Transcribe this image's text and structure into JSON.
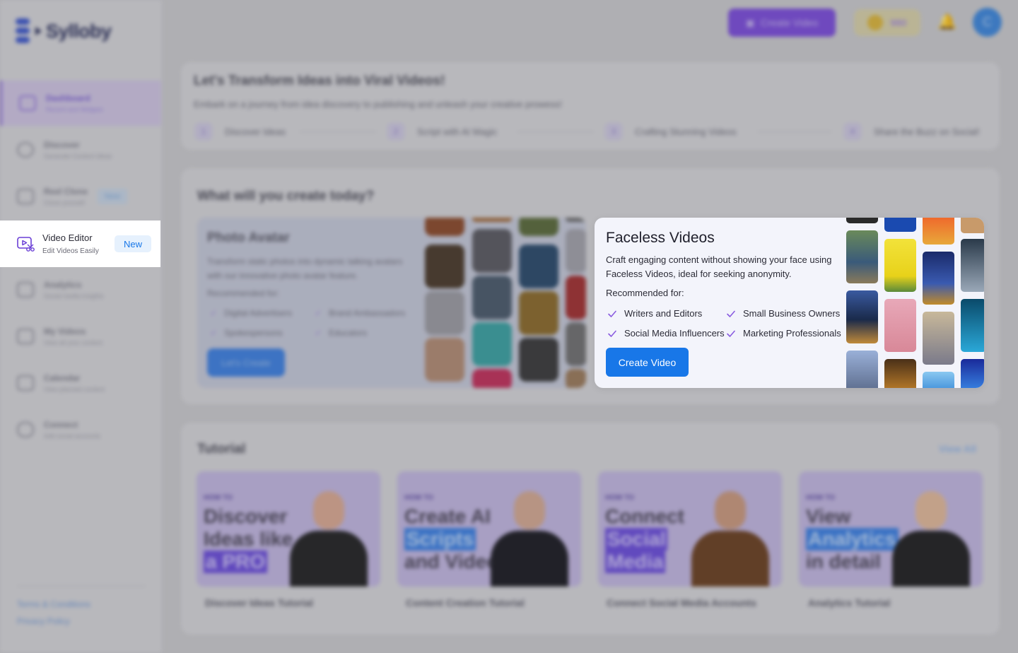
{
  "brand": {
    "name": "Sylloby"
  },
  "colors": {
    "accent": "#1877e8",
    "purple": "#7a4cd8",
    "badge_bg": "#e6f1fd"
  },
  "topbar": {
    "create_label": "Create Video",
    "coins": "980",
    "avatar_initial": "C"
  },
  "sidebar": {
    "items": [
      {
        "title": "Dashboard",
        "sub": "Recent and Widgets",
        "icon": "grid-icon"
      },
      {
        "title": "Discover",
        "sub": "Generate Content Ideas",
        "icon": "search-icon"
      },
      {
        "title": "Reel Clone",
        "sub": "Clone yourself",
        "badge": "New",
        "icon": "clone-icon"
      },
      {
        "title": "Video Editor",
        "sub": "Edit Videos Easily",
        "badge": "New",
        "icon": "video-edit-icon"
      },
      {
        "title": "Analytics",
        "sub": "Social media insights",
        "icon": "chart-icon"
      },
      {
        "title": "My Videos",
        "sub": "View all your content",
        "icon": "videos-icon"
      },
      {
        "title": "Calendar",
        "sub": "View planned content",
        "icon": "calendar-icon"
      },
      {
        "title": "Connect",
        "sub": "Add social accounts",
        "icon": "link-icon"
      }
    ],
    "footer": {
      "terms": "Terms & Conditions",
      "privacy": "Privacy Policy"
    }
  },
  "hero": {
    "title": "Let's Transform Ideas into Viral Videos!",
    "subtitle": "Embark on a journey from idea discovery to publishing and unleash your creative prowess!",
    "steps": [
      {
        "num": "1",
        "label": "Discover Ideas"
      },
      {
        "num": "2",
        "label": "Script with AI Magic"
      },
      {
        "num": "3",
        "label": "Crafting Stunning Videos"
      },
      {
        "num": "4",
        "label": "Share the Buzz on Social!"
      }
    ]
  },
  "create": {
    "title": "What will you create today?",
    "photo_avatar": {
      "title": "Photo Avatar",
      "desc": "Transform static photos into dynamic talking avatars with our innovative photo avatar feature.",
      "rec_label": "Recommended for:",
      "items": [
        "Digital Advertisers",
        "Brand Ambassadors",
        "Spokespersons",
        "Educators"
      ],
      "button": "Let's Create"
    },
    "faceless": {
      "title": "Faceless Videos",
      "desc": "Craft engaging content without showing your face using Faceless Videos, ideal for seeking anonymity.",
      "rec_label": "Recommended for:",
      "items": [
        "Writers and Editors",
        "Small Business Owners",
        "Social Media Influencers",
        "Marketing Professionals"
      ],
      "button": "Create Video"
    }
  },
  "tutorial": {
    "title": "Tutorial",
    "view_all": "View All",
    "cards": [
      {
        "howto": "HOW TO",
        "lines": [
          "Discover",
          "Ideas like",
          "a PRO"
        ],
        "caption": "Discover Ideas Tutorial"
      },
      {
        "howto": "HOW TO",
        "lines": [
          "Create AI",
          "Scripts",
          "and Videos"
        ],
        "caption": "Content Creation Tutorial"
      },
      {
        "howto": "HOW TO",
        "lines": [
          "Connect",
          "Social",
          "Media"
        ],
        "caption": "Connect Social Media Accounts"
      },
      {
        "howto": "HOW TO",
        "lines": [
          "View",
          "Analytics",
          "in detail"
        ],
        "caption": "Analytics Tutorial"
      }
    ]
  }
}
